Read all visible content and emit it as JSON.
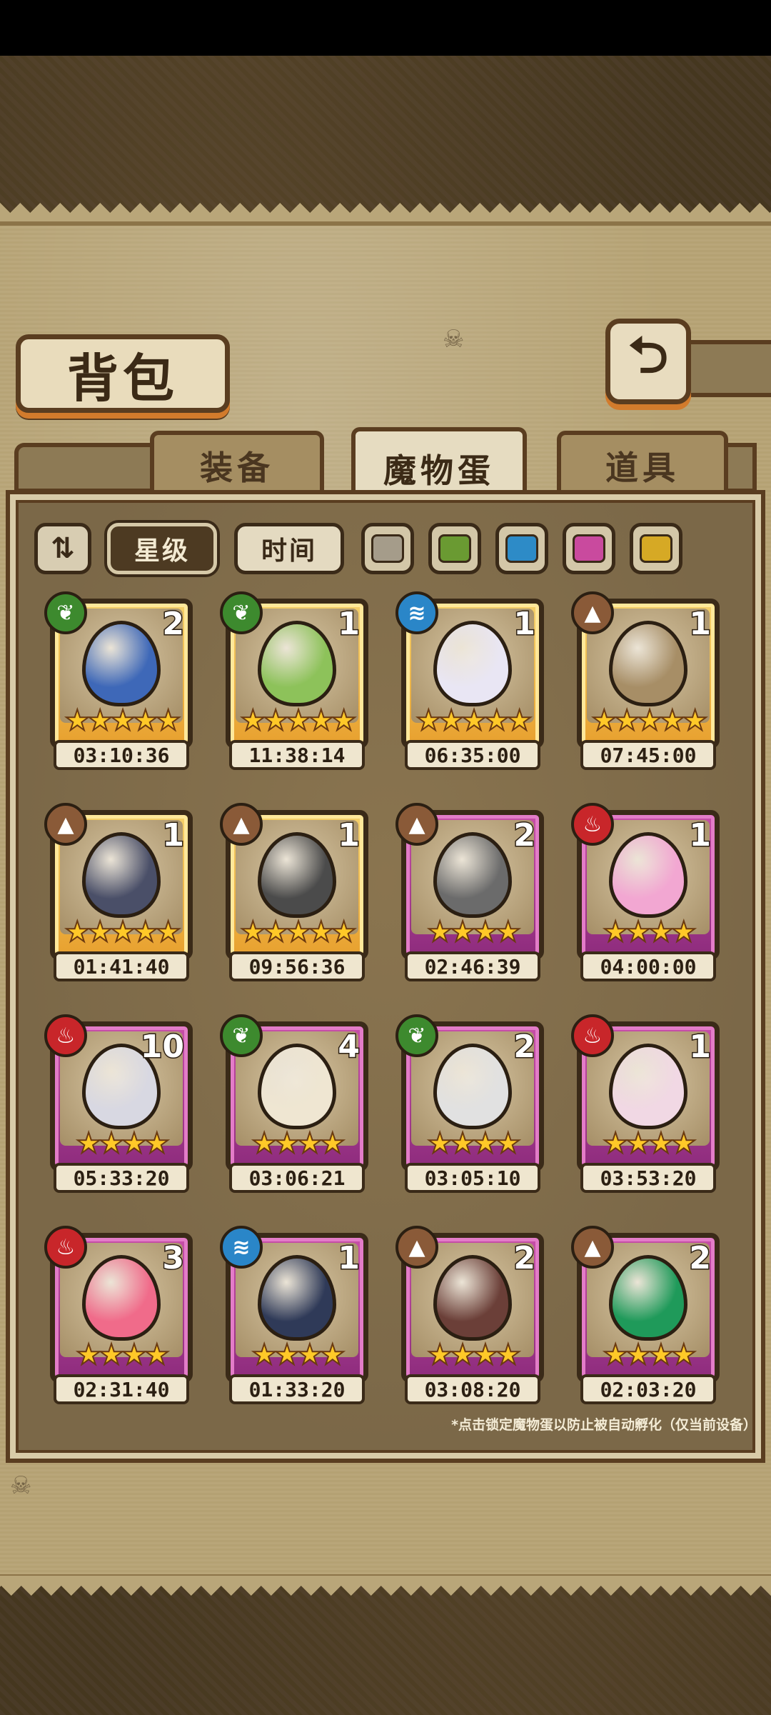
{
  "header": {
    "title": "背包",
    "back_icon": "back-arrow-icon"
  },
  "tabs": [
    {
      "label": "装备",
      "active": false
    },
    {
      "label": "魔物蛋",
      "active": true
    },
    {
      "label": "道具",
      "active": false
    }
  ],
  "filters": {
    "sort_icon": "sort-toggle-icon",
    "star_label": "星级",
    "time_label": "时间",
    "colors": [
      "#a59c8a",
      "#6a9a32",
      "#2d8bc7",
      "#c94a9e",
      "#d6a925"
    ]
  },
  "eggs": [
    {
      "count": "2",
      "stars": "★★★★★",
      "timer": "03:10:36",
      "element": "grass",
      "rarity": "gold",
      "color": "#3e68b8"
    },
    {
      "count": "1",
      "stars": "★★★★★",
      "timer": "11:38:14",
      "element": "grass",
      "rarity": "gold",
      "color": "#8dc25a"
    },
    {
      "count": "1",
      "stars": "★★★★★",
      "timer": "06:35:00",
      "element": "water",
      "rarity": "gold",
      "color": "#e9e6f4"
    },
    {
      "count": "1",
      "stars": "★★★★★",
      "timer": "07:45:00",
      "element": "earth",
      "rarity": "gold",
      "color": "#a78e66"
    },
    {
      "count": "1",
      "stars": "★★★★★",
      "timer": "01:41:40",
      "element": "earth",
      "rarity": "gold",
      "color": "#4a4f68"
    },
    {
      "count": "1",
      "stars": "★★★★★",
      "timer": "09:56:36",
      "element": "earth",
      "rarity": "gold",
      "color": "#4b4b4b"
    },
    {
      "count": "2",
      "stars": "★★★★",
      "timer": "02:46:39",
      "element": "earth",
      "rarity": "purple",
      "color": "#6b6b6b"
    },
    {
      "count": "1",
      "stars": "★★★★",
      "timer": "04:00:00",
      "element": "fire",
      "rarity": "purple",
      "color": "#f2a7d2"
    },
    {
      "count": "10",
      "stars": "★★★★",
      "timer": "05:33:20",
      "element": "fire",
      "rarity": "purple",
      "color": "#d8d8e2"
    },
    {
      "count": "4",
      "stars": "★★★★",
      "timer": "03:06:21",
      "element": "grass",
      "rarity": "purple",
      "color": "#efe6d2"
    },
    {
      "count": "2",
      "stars": "★★★★",
      "timer": "03:05:10",
      "element": "grass",
      "rarity": "purple",
      "color": "#e1e1e1"
    },
    {
      "count": "1",
      "stars": "★★★★",
      "timer": "03:53:20",
      "element": "fire",
      "rarity": "purple",
      "color": "#f1d8e4"
    },
    {
      "count": "3",
      "stars": "★★★★",
      "timer": "02:31:40",
      "element": "fire",
      "rarity": "purple",
      "color": "#f06b8a"
    },
    {
      "count": "1",
      "stars": "★★★★",
      "timer": "01:33:20",
      "element": "water",
      "rarity": "purple",
      "color": "#2f3a58"
    },
    {
      "count": "2",
      "stars": "★★★★",
      "timer": "03:08:20",
      "element": "earth",
      "rarity": "purple",
      "color": "#6b3f38"
    },
    {
      "count": "2",
      "stars": "★★★★",
      "timer": "02:03:20",
      "element": "earth",
      "rarity": "purple",
      "color": "#1f9a5a"
    }
  ],
  "footer_note": "*点击锁定魔物蛋以防止被自动孵化（仅当前设备）"
}
